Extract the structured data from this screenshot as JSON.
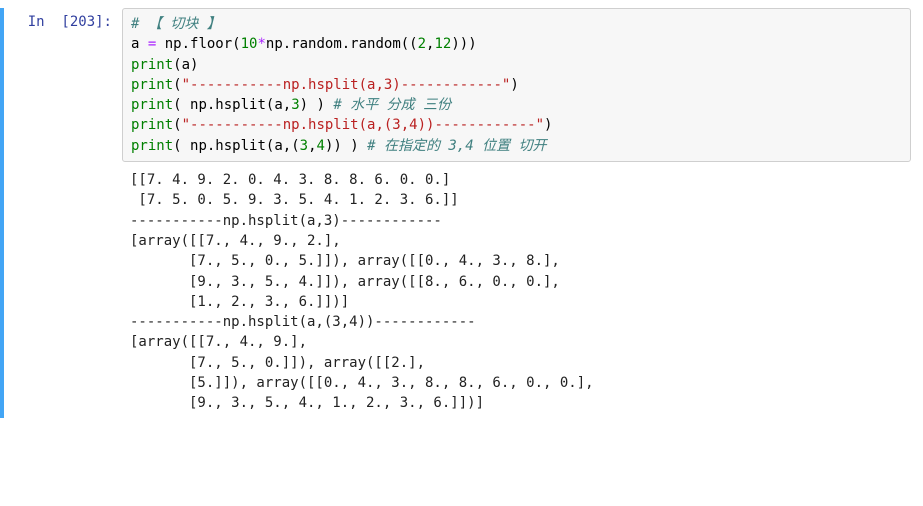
{
  "prompt": "In  [203]:",
  "code": {
    "l1_comment": "# 【 切块 】",
    "l2_a": "a ",
    "l2_eq": "=",
    "l2_np": " np.floor",
    "l2_p1": "(",
    "l2_num10": "10",
    "l2_mul": "*",
    "l2_rand": "np.random.random",
    "l2_p2": "((",
    "l2_n2": "2",
    "l2_comma": ",",
    "l2_n12": "12",
    "l2_p3": ")))",
    "l3_print": "print",
    "l3_p1": "(",
    "l3_a": "a",
    "l3_p2": ")",
    "l4_print": "print",
    "l4_p1": "(",
    "l4_str": "\"-----------np.hsplit(a,3)------------\"",
    "l4_p2": ")",
    "l5_print": "print",
    "l5_p1": "( ",
    "l5_fn": "np.hsplit",
    "l5_p2": "(",
    "l5_a": "a",
    "l5_comma": ",",
    "l5_n3": "3",
    "l5_p3": ") )",
    "l5_comment": " # 水平 分成 三份",
    "l6_print": "print",
    "l6_p1": "(",
    "l6_str": "\"-----------np.hsplit(a,(3,4))------------\"",
    "l6_p2": ")",
    "l7_print": "print",
    "l7_p1": "( ",
    "l7_fn": "np.hsplit",
    "l7_p2": "(",
    "l7_a": "a",
    "l7_comma": ",",
    "l7_p3": "(",
    "l7_n3": "3",
    "l7_comma2": ",",
    "l7_n4": "4",
    "l7_p4": ")) )",
    "l7_comment": " # 在指定的 3,4 位置 切开"
  },
  "output": "[[7. 4. 9. 2. 0. 4. 3. 8. 8. 6. 0. 0.]\n [7. 5. 0. 5. 9. 3. 5. 4. 1. 2. 3. 6.]]\n-----------np.hsplit(a,3)------------\n[array([[7., 4., 9., 2.],\n       [7., 5., 0., 5.]]), array([[0., 4., 3., 8.],\n       [9., 3., 5., 4.]]), array([[8., 6., 0., 0.],\n       [1., 2., 3., 6.]])]\n-----------np.hsplit(a,(3,4))------------\n[array([[7., 4., 9.],\n       [7., 5., 0.]]), array([[2.],\n       [5.]]), array([[0., 4., 3., 8., 8., 6., 0., 0.],\n       [9., 3., 5., 4., 1., 2., 3., 6.]])]"
}
